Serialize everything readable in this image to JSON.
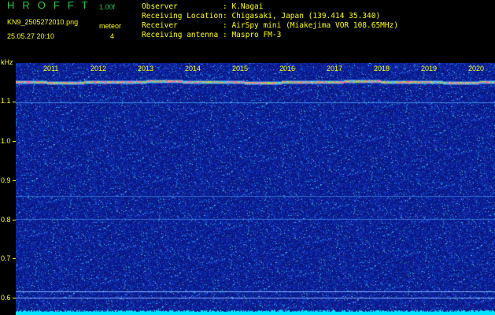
{
  "header": {
    "app_title": "H R O F F T",
    "version": "1.00f",
    "filename": "KN9_2505272010.png",
    "datetime": "25.05.27 20:10",
    "meteor_label": "meteor",
    "meteor_count": "4"
  },
  "info": [
    {
      "label": "Observer",
      "value": ": K.Nagai"
    },
    {
      "label": "Receiving Location",
      "value": ": Chigasaki, Japan (139.414 35.340)"
    },
    {
      "label": "Receiver",
      "value": ": AirSpy mini (Miakejima VOR 108.65MHz)"
    },
    {
      "label": "Receiving antenna",
      "value": ": Maspro FM-3"
    }
  ],
  "axis": {
    "unit": "kHz",
    "y_labels": [
      "1.1",
      "1.0",
      "0.9",
      "0.8",
      "0.7",
      "0.6"
    ],
    "x_labels": [
      "2011",
      "2012",
      "2013",
      "2014",
      "2015",
      "2016",
      "2017",
      "2018",
      "2019",
      "2020"
    ]
  },
  "colors": {
    "background": "#0a1a78",
    "label": "#ffff00",
    "title": "#22c84a",
    "noise_floor": "#00e5ff"
  }
}
